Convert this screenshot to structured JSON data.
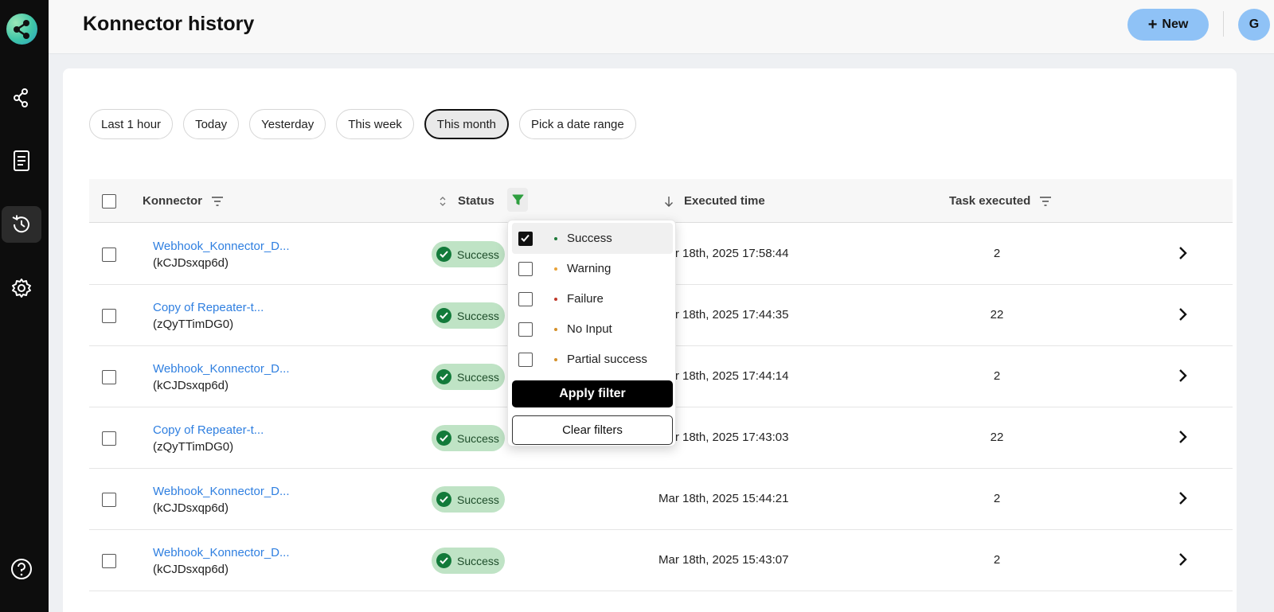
{
  "header": {
    "title": "Konnector history",
    "new_button": "New",
    "avatar_initial": "G"
  },
  "sidebar": {
    "items": [
      {
        "icon": "konnectors-icon",
        "active": false
      },
      {
        "icon": "logs-icon",
        "active": false
      },
      {
        "icon": "history-icon",
        "active": true
      },
      {
        "icon": "settings-icon",
        "active": false
      },
      {
        "icon": "help-icon",
        "active": false
      }
    ]
  },
  "date_filters": [
    "Last 1 hour",
    "Today",
    "Yesterday",
    "This week",
    "This month",
    "Pick a date range"
  ],
  "active_date_filter": "This month",
  "table": {
    "columns": {
      "konnector": "Konnector",
      "status": "Status",
      "executed_time": "Executed time",
      "task_executed": "Task executed"
    },
    "rows": [
      {
        "name": "Webhook_Konnector_D...",
        "id": "(kCJDsxqp6d)",
        "status": "Success",
        "time": "Mar 18th, 2025 17:58:44",
        "tasks": "2"
      },
      {
        "name": "Copy of Repeater-t...",
        "id": "(zQyTTimDG0)",
        "status": "Success",
        "time": "Mar 18th, 2025 17:44:35",
        "tasks": "22"
      },
      {
        "name": "Webhook_Konnector_D...",
        "id": "(kCJDsxqp6d)",
        "status": "Success",
        "time": "Mar 18th, 2025 17:44:14",
        "tasks": "2"
      },
      {
        "name": "Copy of Repeater-t...",
        "id": "(zQyTTimDG0)",
        "status": "Success",
        "time": "Mar 18th, 2025 17:43:03",
        "tasks": "22"
      },
      {
        "name": "Webhook_Konnector_D...",
        "id": "(kCJDsxqp6d)",
        "status": "Success",
        "time": "Mar 18th, 2025 15:44:21",
        "tasks": "2"
      },
      {
        "name": "Webhook_Konnector_D...",
        "id": "(kCJDsxqp6d)",
        "status": "Success",
        "time": "Mar 18th, 2025 15:43:07",
        "tasks": "2"
      }
    ]
  },
  "status_filter": {
    "options": [
      {
        "label": "Success",
        "checked": true,
        "color": "#1f7a3a"
      },
      {
        "label": "Warning",
        "checked": false,
        "color": "#e8a33a"
      },
      {
        "label": "Failure",
        "checked": false,
        "color": "#c0392b"
      },
      {
        "label": "No Input",
        "checked": false,
        "color": "#d4902a"
      },
      {
        "label": "Partial success",
        "checked": false,
        "color": "#d4902a"
      }
    ],
    "apply_label": "Apply filter",
    "clear_label": "Clear filters"
  },
  "colors": {
    "accent": "#8fc2f6",
    "link": "#2f7fe0",
    "success_bg": "#bfe3c5",
    "success_icon": "#127a3a",
    "filter_icon": "#2e9e3f"
  }
}
